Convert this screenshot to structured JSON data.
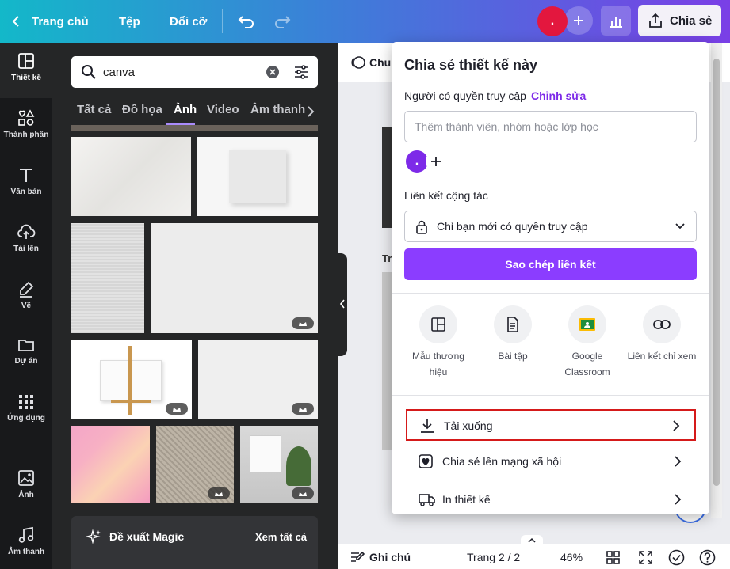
{
  "topbar": {
    "home_label": "Trang chủ",
    "file_label": "Tệp",
    "resize_label": "Đổi cỡ",
    "avatar_initial": ".",
    "share_label": "Chia sẻ"
  },
  "rail": {
    "items": [
      {
        "label": "Thiết kế",
        "icon": "layout-icon"
      },
      {
        "label": "Thành phần",
        "icon": "shapes-icon"
      },
      {
        "label": "Văn bản",
        "icon": "text-icon"
      },
      {
        "label": "Tải lên",
        "icon": "upload-cloud-icon"
      },
      {
        "label": "Vẽ",
        "icon": "draw-pen-icon"
      },
      {
        "label": "Dự án",
        "icon": "folder-icon"
      },
      {
        "label": "Ứng dụng",
        "icon": "apps-grid-icon"
      },
      {
        "label": "Ảnh",
        "icon": "image-icon"
      },
      {
        "label": "Âm thanh",
        "icon": "music-icon"
      }
    ]
  },
  "panel": {
    "search_value": "canva",
    "categories": [
      "Tất cả",
      "Đồ họa",
      "Ảnh",
      "Video",
      "Âm thanh"
    ],
    "active_category": "Ảnh",
    "magic_title": "Đề xuất Magic",
    "magic_see_all": "Xem tất cả"
  },
  "canvas": {
    "toolbar_partial": "Chu",
    "page_label_partial": "Tr"
  },
  "bottombar": {
    "notes_label": "Ghi chú",
    "page_indicator": "Trang 2 / 2",
    "zoom": "46%"
  },
  "share_modal": {
    "title": "Chia sẻ thiết kế này",
    "access_label": "Người có quyền truy cập",
    "edit_link": "Chỉnh sửa",
    "member_placeholder": "Thêm thành viên, nhóm hoặc lớp học",
    "avatar_initial": ".",
    "collab_label": "Liên kết cộng tác",
    "collab_value": "Chỉ bạn mới có quyền truy cập",
    "copy_link_button": "Sao chép liên kết",
    "options": [
      {
        "label": "Mẫu thương hiệu",
        "icon": "brand-template-icon"
      },
      {
        "label": "Bài tập",
        "icon": "assignment-doc-icon"
      },
      {
        "label": "Google Classroom",
        "icon": "google-classroom-icon"
      },
      {
        "label": "Liên kết chỉ xem",
        "icon": "link-icon"
      }
    ],
    "rows": [
      {
        "label": "Tải xuống",
        "icon": "download-icon",
        "highlighted": true
      },
      {
        "label": "Chia sẻ lên mạng xã hội",
        "icon": "heart-icon"
      },
      {
        "label": "In thiết kế",
        "icon": "truck-icon"
      }
    ]
  },
  "colors": {
    "brand_purple": "#8b3dff",
    "link_purple": "#7d2ae8",
    "highlight_red": "#d51a1a",
    "avatar_red": "#e3173e",
    "gradient_start": "#13b8c9",
    "gradient_end": "#7a3fe6"
  }
}
